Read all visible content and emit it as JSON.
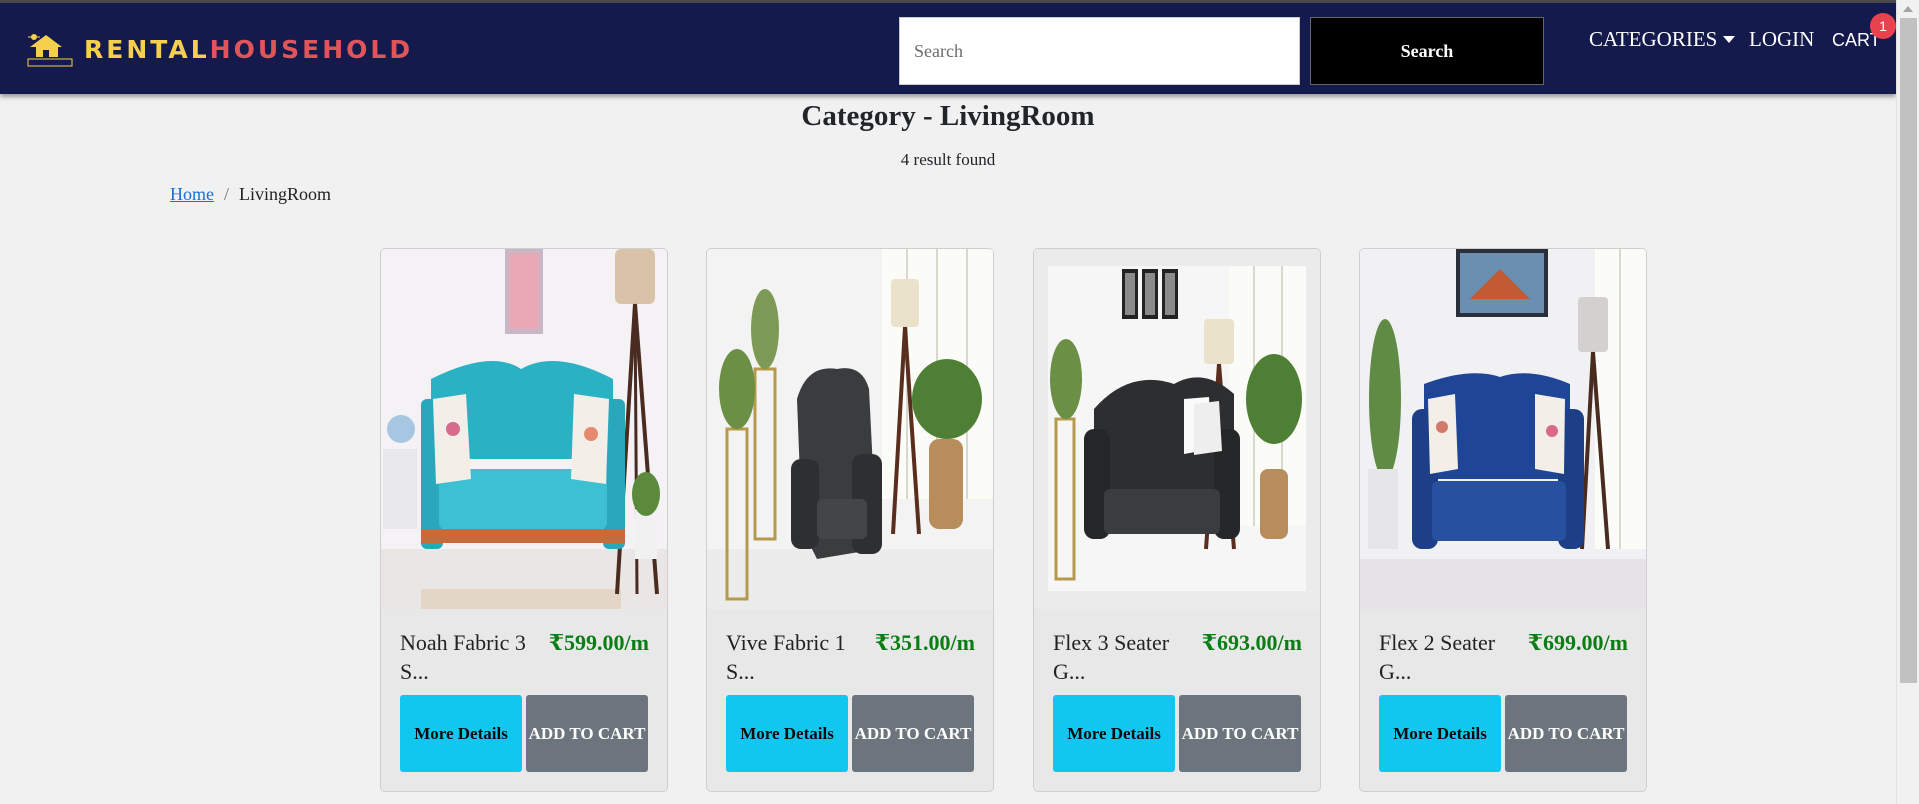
{
  "header": {
    "logo_part1": "RENTAL",
    "logo_part2": "HOUSEHOLD",
    "search_placeholder": "Search",
    "search_button": "Search",
    "nav_categories": "CATEGORIES",
    "nav_login": "LOGIN",
    "nav_cart": "CART",
    "cart_count": "1"
  },
  "page": {
    "title": "Category - LivingRoom",
    "result_count": "4 result found"
  },
  "breadcrumb": {
    "home": "Home",
    "current": "LivingRoom"
  },
  "products": [
    {
      "name": "Noah Fabric 3 S...",
      "price": "₹599.00/m",
      "details_label": "More Details",
      "cart_label": "ADD TO CART",
      "sofa_color": "#2bb1c4",
      "sofa_type": "armchair"
    },
    {
      "name": "Vive Fabric 1 S...",
      "price": "₹351.00/m",
      "details_label": "More Details",
      "cart_label": "ADD TO CART",
      "sofa_color": "#3a3c3e",
      "sofa_type": "recliner"
    },
    {
      "name": "Flex 3 Seater G...",
      "price": "₹693.00/m",
      "details_label": "More Details",
      "cart_label": "ADD TO CART",
      "sofa_color": "#2c2e30",
      "sofa_type": "loveseat"
    },
    {
      "name": "Flex 2 Seater G...",
      "price": "₹699.00/m",
      "details_label": "More Details",
      "cart_label": "ADD TO CART",
      "sofa_color": "#1f4696",
      "sofa_type": "loveseat"
    }
  ],
  "colors": {
    "navbar": "#141a4b",
    "price_green": "#0a7d14",
    "details_button": "#10c8ef",
    "cart_button": "#6c757d",
    "badge": "#e8424e"
  }
}
